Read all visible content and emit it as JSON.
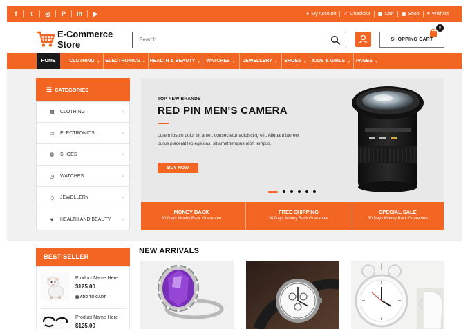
{
  "topbar": {
    "social_icons": [
      "facebook-icon",
      "twitter-icon",
      "instagram-icon",
      "pinterest-icon",
      "linkedin-icon",
      "youtube-icon"
    ],
    "social_glyphs": [
      "f",
      "t",
      "◎",
      "P",
      "in",
      "▶"
    ],
    "links": [
      "My Account",
      "Checkout",
      "Cart",
      "Shop",
      "Wishlist"
    ]
  },
  "header": {
    "logo_line1": "E-Commerce",
    "logo_line2": "Store",
    "search_placeholder": "Search",
    "cart_label": "SHOPPING CART",
    "cart_count": "0"
  },
  "nav": {
    "items": [
      "HOME",
      "CLOTHING",
      "ELECTRONICS",
      "HEALTH & BEAUTY",
      "WATCHES",
      "JEWELLERY",
      "SHOES",
      "KIDS & GIRLS",
      "PAGES"
    ]
  },
  "categories": {
    "title": "CATEGORIES",
    "items": [
      "CLOTHING",
      "ELECTRONICS",
      "SHOES",
      "WATCHES",
      "JEWELLERY",
      "HEALTH AND BEAUTY"
    ]
  },
  "hero": {
    "subtitle": "TOP NEW BRANDS",
    "title": "RED PIN MEN'S CAMERA",
    "description": "Lorem ipsum dolor sit amet, consectetur adipiscing elit. Aliquam laoreet purus placerat leo egestas, sit amet tempus nibh tempus.",
    "button": "BUY NOW",
    "slides": 6,
    "active_slide": 1
  },
  "features": [
    {
      "title": "MONEY BACK",
      "subtitle": "30 Days Money Back Guarantee"
    },
    {
      "title": "FREE SHIPPING",
      "subtitle": "30 Days Money Back Guarantee"
    },
    {
      "title": "SPECIAL SALE",
      "subtitle": "30 Days Money Back Guarantee"
    }
  ],
  "best_seller": {
    "title": "BEST SELLER",
    "products": [
      {
        "name": "Product Name Here",
        "price": "$125.00",
        "add_label": "ADD TO CART"
      },
      {
        "name": "Product Name Here",
        "price": "$125.00"
      }
    ]
  },
  "new_arrivals": {
    "title": "NEW ARRIVALS"
  },
  "colors": {
    "accent": "#f26522",
    "dark": "#1a1a1a"
  }
}
